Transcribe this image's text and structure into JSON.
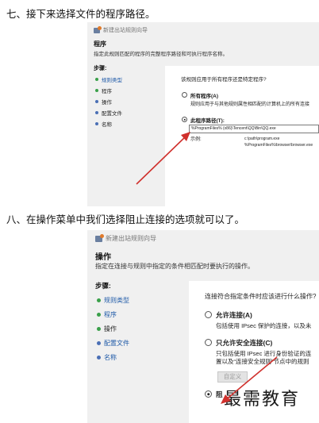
{
  "step7": {
    "heading": "七、接下来选择文件的程序路径。",
    "wizard_title": "新建出站规则向导",
    "page_title": "程序",
    "page_description": "指定此规则匹配的程序的完整程序路径和可执行程序名称。",
    "steps_label": "步骤:",
    "steps": [
      "规则类型",
      "程序",
      "操作",
      "配置文件",
      "名称"
    ],
    "question": "该规则应用于所有程序还是特定程序?",
    "all_programs": {
      "label": "所有程序(A)",
      "description": "规则应用于与其他规则属性相匹配的计算机上的所有连接"
    },
    "this_program": {
      "label": "此程序路径(T):",
      "value": "%ProgramFiles% (x86)\\Tencent\\QQ\\Bin\\QQ.exe"
    },
    "example_label": "示例:",
    "example_paths": [
      "c:\\path\\program.exe",
      "%ProgramFiles%\\browser\\browser.exe"
    ]
  },
  "step8": {
    "heading": "八、在操作菜单中我们选择阻止连接的选项就可以了。",
    "wizard_title": "新建出站规则向导",
    "page_title": "操作",
    "page_description": "指定在连接与规则中指定的条件相匹配时要执行的操作。",
    "steps_label": "步骤:",
    "steps": [
      "规则类型",
      "程序",
      "操作",
      "配置文件",
      "名称"
    ],
    "question": "连接符合指定条件时应该进行什么操作?",
    "allow": {
      "label": "允许连接(A)",
      "description": "包括使用 IPsec 保护的连接，以及未"
    },
    "allow_secure": {
      "label": "只允许安全连接(C)",
      "description_line1": "只包括使用 IPsec 进行身份验证的连",
      "description_line2": "置以及“连接安全规则”节点中的规则"
    },
    "customize_button": "自定义",
    "block": {
      "label": "阻"
    }
  },
  "watermark": "最需教育",
  "colors": {
    "arrow": "#d0312d",
    "selected_step": "#dce7f5",
    "green_bullet": "#3aa04a",
    "blue_bullet": "#4a6fb5"
  }
}
